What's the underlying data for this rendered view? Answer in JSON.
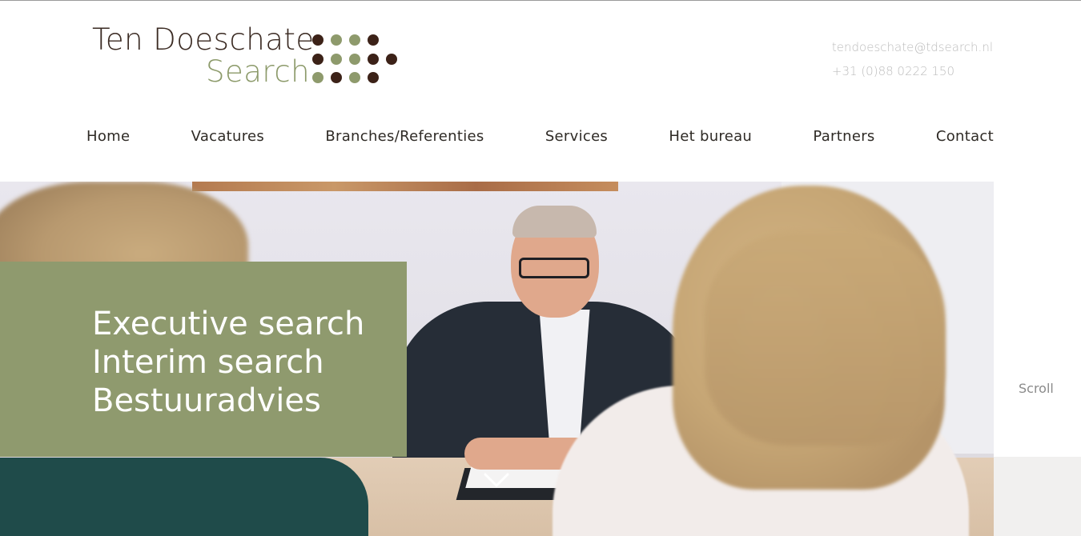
{
  "logo": {
    "line1": "Ten Doeschate",
    "line2": "Search",
    "dot_colors": {
      "brown": "#3c2218",
      "green": "#8e9a6c"
    }
  },
  "contact": {
    "email": "tendoeschate@tdsearch.nl",
    "phone": "+31 (0)88 0222 150"
  },
  "nav": {
    "items": [
      {
        "label": "Home"
      },
      {
        "label": "Vacatures"
      },
      {
        "label": "Branches/Referenties"
      },
      {
        "label": "Services"
      },
      {
        "label": "Het bureau"
      },
      {
        "label": "Partners"
      },
      {
        "label": "Contact"
      }
    ]
  },
  "hero": {
    "lines": [
      "Executive search",
      "Interim search",
      "Bestuuradvies"
    ],
    "box_color": "#8f9a6e",
    "scroll_down_icon": "chevron-down-icon"
  },
  "scroll": {
    "label": "Scroll"
  }
}
